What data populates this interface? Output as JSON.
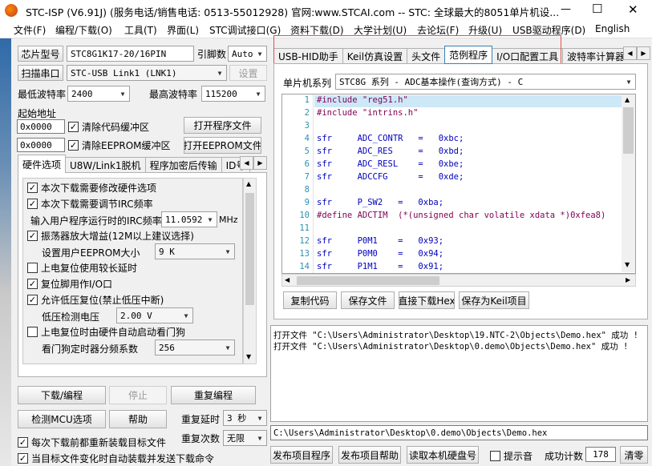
{
  "title": "STC-ISP (V6.91J) (服务电话/销售电话: 0513-55012928) 官网:www.STCAI.com  -- STC: 全球最大的8051单片机设...",
  "window_controls": [
    "—",
    "☐",
    "✕"
  ],
  "menu": [
    "文件(F)",
    "编程/下载(O)",
    "工具(T)",
    "界面(L)",
    "STC调试接口(G)",
    "资料下载(D)",
    "大学计划(U)",
    "去论坛(F)",
    "升级(U)",
    "USB驱动程序(D)",
    "English"
  ],
  "left": {
    "chip_btn": "芯片型号",
    "chip_value": "STC8G1K17-20/16PIN",
    "pins_label": "引脚数",
    "pins_value": "Auto",
    "scan_btn": "扫描串口",
    "port_value": "STC-USB Link1 (LNK1)",
    "settings_btn": "设置",
    "min_baud_label": "最低波特率",
    "min_baud_value": "2400",
    "max_baud_label": "最高波特率",
    "max_baud_value": "115200",
    "start_addr_label": "起始地址",
    "addr1": "0x0000",
    "addr2": "0x0000",
    "clear_code": "清除代码缓冲区",
    "clear_eeprom": "清除EEPROM缓冲区",
    "open_prog_btn": "打开程序文件",
    "open_eeprom_btn": "打开EEPROM文件",
    "tabs": [
      "硬件选项",
      "U8W/Link1脱机",
      "程序加密后传输",
      "ID号"
    ],
    "options": {
      "opt1": "本次下载需要修改硬件选项",
      "opt2": "本次下载需要调节IRC频率",
      "irc_label": "输入用户程序运行时的IRC频率",
      "irc_value": "11.0592",
      "irc_unit": "MHz",
      "opt3": "振荡器放大增益(12M以上建议选择)",
      "eeprom_label": "设置用户EEPROM大小",
      "eeprom_value": "9   K",
      "opt4": "上电复位使用较长延时",
      "opt5": "复位脚用作I/O口",
      "opt6": "允许低压复位(禁止低压中断)",
      "lv_label": "低压检测电压",
      "lv_value": "2.00 V",
      "opt7": "上电复位时由硬件自动启动看门狗",
      "wdt_label": "看门狗定时器分频系数",
      "wdt_value": "256"
    },
    "download_btn": "下载/编程",
    "stop_btn": "停止",
    "reprog_btn": "重复编程",
    "detect_btn": "检测MCU选项",
    "help_btn": "帮助",
    "delay_label": "重复延时",
    "delay_value": "3 秒",
    "count_label": "重复次数",
    "count_value": "无限",
    "reload_opt": "每次下载前都重新装载目标文件",
    "auto_opt": "当目标文件变化时自动装载并发送下载命令"
  },
  "right": {
    "tabs": [
      "USB-HID助手",
      "Keil仿真设置",
      "头文件",
      "范例程序",
      "I/O口配置工具",
      "波特率计算器"
    ],
    "mcu_label": "单片机系列",
    "mcu_value": "STC8G 系列 - ADC基本操作(查询方式) - C",
    "code_lines": [
      {
        "n": "1",
        "t": "#include \"reg51.h\""
      },
      {
        "n": "2",
        "t": "#include \"intrins.h\""
      },
      {
        "n": "3",
        "t": ""
      },
      {
        "n": "4",
        "t": "sfr     ADC_CONTR   =   0xbc;"
      },
      {
        "n": "5",
        "t": "sfr     ADC_RES     =   0xbd;"
      },
      {
        "n": "6",
        "t": "sfr     ADC_RESL    =   0xbe;"
      },
      {
        "n": "7",
        "t": "sfr     ADCCFG      =   0xde;"
      },
      {
        "n": "8",
        "t": ""
      },
      {
        "n": "9",
        "t": "sfr     P_SW2   =   0xba;"
      },
      {
        "n": "10",
        "t": "#define ADCTIM  (*(unsigned char volatile xdata *)0xfea8)"
      },
      {
        "n": "11",
        "t": ""
      },
      {
        "n": "12",
        "t": "sfr     P0M1    =   0x93;"
      },
      {
        "n": "13",
        "t": "sfr     P0M0    =   0x94;"
      },
      {
        "n": "14",
        "t": "sfr     P1M1    =   0x91;"
      }
    ],
    "copy_btn": "复制代码",
    "save_btn": "保存文件",
    "hex_btn": "直接下载Hex",
    "keil_btn": "保存为Keil项目",
    "log": [
      "打开文件 \"C:\\Users\\Administrator\\Desktop\\19.NTC-2\\Objects\\Demo.hex\" 成功 !",
      "打开文件 \"C:\\Users\\Administrator\\Desktop\\0.demo\\Objects\\Demo.hex\" 成功 !"
    ],
    "path": "C:\\Users\\Administrator\\Desktop\\0.demo\\Objects\\Demo.hex",
    "pub_btn": "发布项目程序",
    "pub_help_btn": "发布项目帮助",
    "disk_btn": "读取本机硬盘号",
    "sound_label": "提示音",
    "success_label": "成功计数",
    "success_value": "178",
    "clear_btn": "清零"
  }
}
